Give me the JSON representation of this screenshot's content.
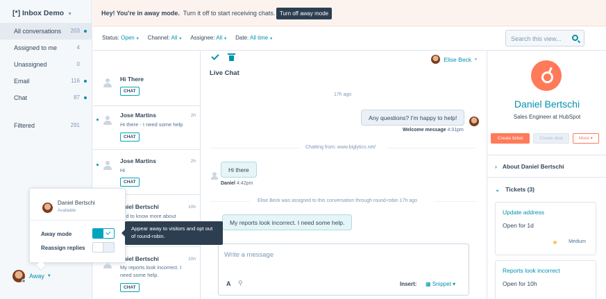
{
  "sidebar": {
    "inbox_title": "[*] Inbox Demo",
    "items": [
      {
        "label": "All conversations",
        "count": "203",
        "dot": true,
        "active": true
      },
      {
        "label": "Assigned to me",
        "count": "4",
        "dot": false
      },
      {
        "label": "Unassigned",
        "count": "0",
        "dot": false
      },
      {
        "label": "Email",
        "count": "116",
        "dot": true
      },
      {
        "label": "Chat",
        "count": "87",
        "dot": true
      }
    ],
    "filtered": {
      "label": "Filtered",
      "count": "291"
    },
    "user_status": "Away"
  },
  "banner": {
    "bold_text": "Hey! You're in away mode.",
    "text": "Turn it off to start receiving chats.",
    "button": "Turn off away mode"
  },
  "filters": {
    "status_label": "Status:",
    "status_value": "Open",
    "channel_label": "Channel:",
    "channel_value": "All",
    "assignee_label": "Assignee:",
    "assignee_value": "All",
    "date_label": "Date:",
    "date_value": "All time"
  },
  "search": {
    "placeholder": "Search this view..."
  },
  "conversations": [
    {
      "name": "Hi There",
      "time": "",
      "snippet": "",
      "tag": "CHAT"
    },
    {
      "name": "Jose Martins",
      "time": "2h",
      "snippet": "Hi there - I need some help",
      "tag": "CHAT"
    },
    {
      "name": "Jose Martins",
      "time": "2h",
      "snippet": "Hi",
      "tag": "CHAT"
    },
    {
      "name": "aniel Bertschi",
      "time": "10h",
      "snippet": "eed to know more about",
      "tag": ""
    },
    {
      "name": "aniel Bertschi",
      "time": "10h",
      "snippet": "My reports look incorrect. I need some help.",
      "tag": "CHAT"
    }
  ],
  "chat": {
    "assignee": "Elise Beck",
    "title": "Live Chat",
    "time_ago": "17h ago",
    "msg1": "Any questions? I'm happy to help!",
    "msg1_meta_label": "Welcome message",
    "msg1_meta_time": "4:31pm",
    "chatting_from": "Chatting from: www.biglytics.net/",
    "msg2": "Hi there",
    "msg2_sender": "Daniel",
    "msg2_time": "4:42pm",
    "assigned_note": "Elise Beck was assigned to this conversation through round-robin 17h ago",
    "msg3": "My reports look incorrect. I need some help.",
    "composer_placeholder": "Write a message",
    "insert_label": "Insert:",
    "snippet_label": "Snippet"
  },
  "contact": {
    "name": "Daniel Bertschi",
    "title": "Sales Engineer at HubSpot",
    "create_ticket": "Create ticket",
    "create_deal": "Create deal",
    "more": "More",
    "about": "About Daniel Bertschi",
    "tickets_header": "Tickets (3)",
    "tickets": [
      {
        "title": "Update address",
        "status": "Open for 1d",
        "priority": "Medium"
      },
      {
        "title": "Reports look incorrect",
        "status": "Open for 10h"
      }
    ]
  },
  "popup": {
    "name": "Daniel Bertschi",
    "status": "Available",
    "away_mode": "Away mode",
    "reassign": "Reassign replies",
    "tooltip": "Appear away to visitors and opt out of round-robin."
  },
  "colors": {
    "accent": "#0091ae",
    "brand": "#ff7a59",
    "dark": "#2d3e50",
    "banner_bg": "#fdf3ee"
  }
}
